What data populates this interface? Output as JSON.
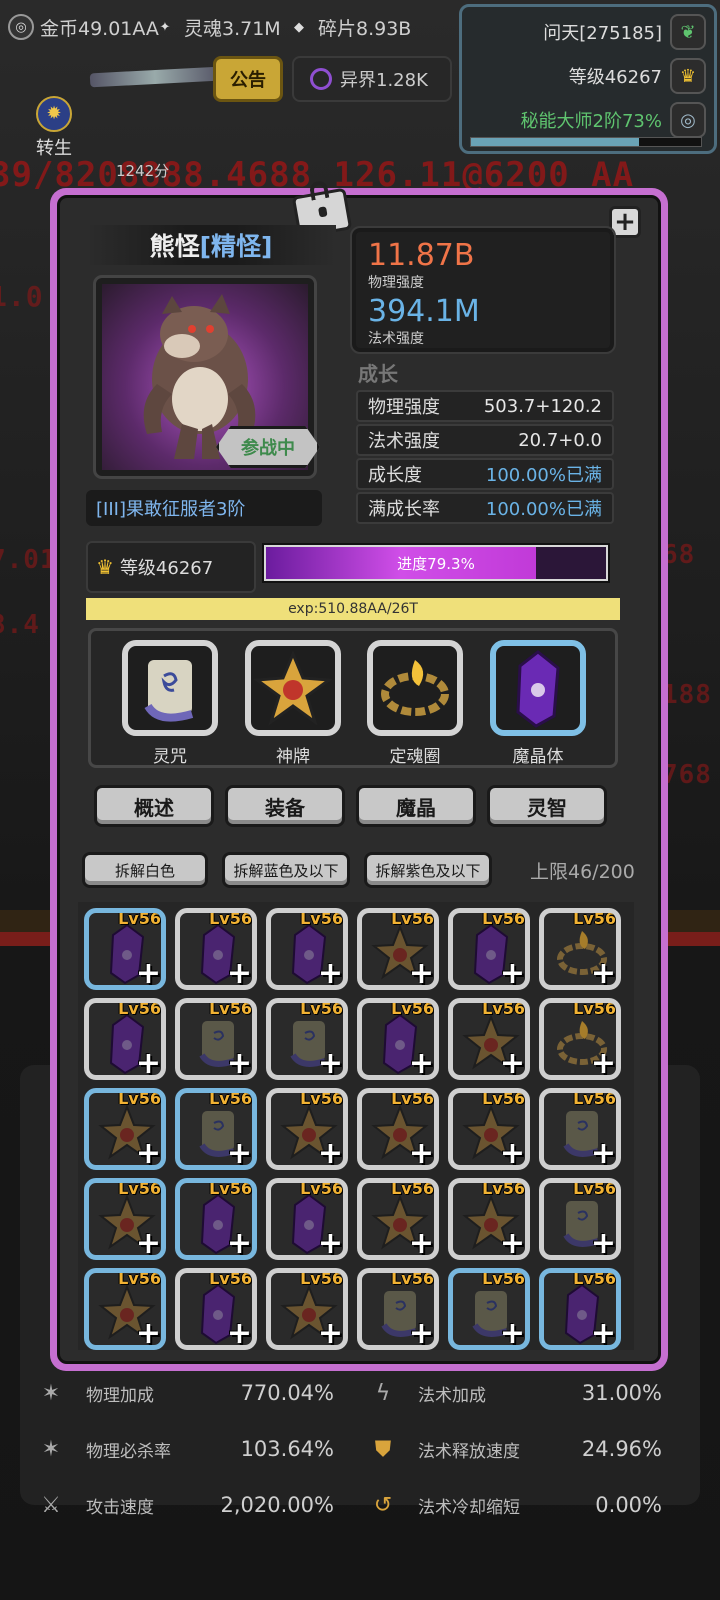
{
  "resources": [
    {
      "icon": "coin-icon",
      "label": "金币49.01AA"
    },
    {
      "icon": "soul-icon",
      "label": "灵魂3.71M"
    },
    {
      "icon": "shard-icon",
      "label": "碎片8.93B"
    }
  ],
  "player": {
    "name": "问天[275185]",
    "level": "等级46267",
    "title": "秘能大师2阶73%",
    "progress": 0.73
  },
  "notice_label": "公告",
  "realm_label": "异界1.28K",
  "left_side": {
    "rebirth": "转生",
    "score": "1242分"
  },
  "monster": {
    "name": "熊怪",
    "rank": "[精怪]",
    "status": "参战中",
    "title": "[III]果敢征服者3阶"
  },
  "power": {
    "physical_value": "11.87B",
    "physical_label": "物理强度",
    "magic_value": "394.1M",
    "magic_label": "法术强度"
  },
  "growth": {
    "header": "成长",
    "rows": [
      {
        "label": "物理强度",
        "value": "503.7+120.2"
      },
      {
        "label": "法术强度",
        "value": "20.7+0.0"
      },
      {
        "label": "成长度",
        "value": "100.00%已满"
      },
      {
        "label": "满成长率",
        "value": "100.00%已满"
      }
    ]
  },
  "level": {
    "label": "等级46267",
    "progress_label": "进度79.3%",
    "progress": 0.793,
    "exp": "exp:510.88AA/26T"
  },
  "equipment": [
    {
      "label": "灵咒",
      "icon": "scroll-icon"
    },
    {
      "label": "神牌",
      "icon": "star-medal-icon"
    },
    {
      "label": "定魂圈",
      "icon": "chain-ring-icon"
    },
    {
      "label": "魔晶体",
      "icon": "crystal-icon"
    }
  ],
  "tabs": [
    "概述",
    "装备",
    "魔晶",
    "灵智"
  ],
  "decompose": {
    "white": "拆解白色",
    "blue": "拆解蓝色及以下",
    "purple": "拆解紫色及以下",
    "limit": "上限46/200"
  },
  "inventory": {
    "level": "Lv56",
    "items": [
      {
        "t": "crystal",
        "b": "blue"
      },
      {
        "t": "crystal",
        "b": "white"
      },
      {
        "t": "crystal",
        "b": "white"
      },
      {
        "t": "star",
        "b": "white"
      },
      {
        "t": "crystal",
        "b": "white"
      },
      {
        "t": "chain",
        "b": "white"
      },
      {
        "t": "crystal",
        "b": "white"
      },
      {
        "t": "scroll",
        "b": "white"
      },
      {
        "t": "scroll",
        "b": "white"
      },
      {
        "t": "crystal",
        "b": "white"
      },
      {
        "t": "star",
        "b": "white"
      },
      {
        "t": "chain",
        "b": "white"
      },
      {
        "t": "star",
        "b": "blue"
      },
      {
        "t": "scroll",
        "b": "blue"
      },
      {
        "t": "star",
        "b": "white"
      },
      {
        "t": "star",
        "b": "white"
      },
      {
        "t": "star",
        "b": "white"
      },
      {
        "t": "scroll",
        "b": "white"
      },
      {
        "t": "star",
        "b": "blue"
      },
      {
        "t": "crystal",
        "b": "blue"
      },
      {
        "t": "crystal",
        "b": "white"
      },
      {
        "t": "star",
        "b": "white"
      },
      {
        "t": "star",
        "b": "white"
      },
      {
        "t": "scroll",
        "b": "white"
      },
      {
        "t": "star",
        "b": "blue"
      },
      {
        "t": "crystal",
        "b": "white"
      },
      {
        "t": "star",
        "b": "white"
      },
      {
        "t": "scroll",
        "b": "white"
      },
      {
        "t": "scroll",
        "b": "blue"
      },
      {
        "t": "crystal",
        "b": "blue"
      }
    ]
  },
  "bottom_stats": [
    {
      "icon": "sword-burst-icon",
      "label": "物理加成",
      "value": "770.04%"
    },
    {
      "icon": "lightning-icon",
      "label": "法术加成",
      "value": "31.00%"
    },
    {
      "icon": "sword-burst-icon",
      "label": "物理必杀率",
      "value": "103.64%"
    },
    {
      "icon": "flame-shield-icon",
      "label": "法术释放速度",
      "value": "24.96%"
    },
    {
      "icon": "crossed-swords-icon",
      "label": "攻击速度",
      "value": "2,020.00%"
    },
    {
      "icon": "swirl-icon",
      "label": "法术冷却缩短",
      "value": "0.00%"
    }
  ]
}
